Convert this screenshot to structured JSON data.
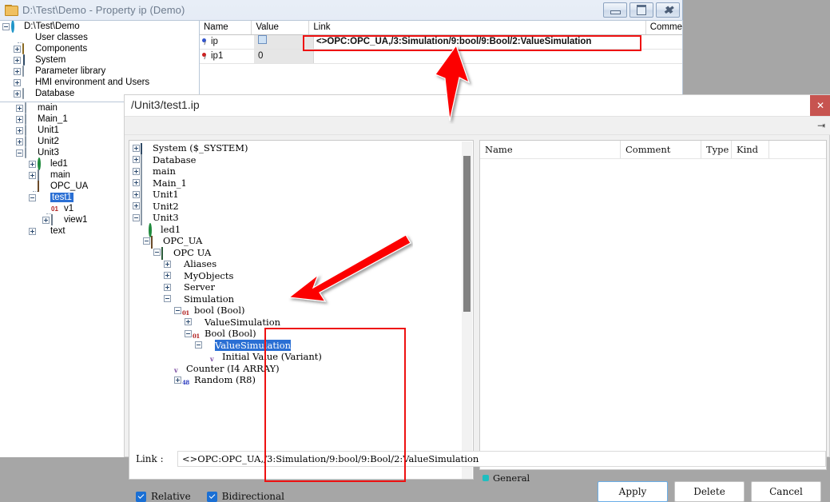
{
  "main_window": {
    "title": "D:\\Test\\Demo - Property ip (Demo)",
    "folder_icon": "folder-icon",
    "window_buttons": [
      {
        "name": "minimize-button",
        "glyph": "minimize"
      },
      {
        "name": "maximize-button",
        "glyph": "maximize"
      },
      {
        "name": "close-button",
        "glyph": "close"
      }
    ],
    "project_tree": [
      {
        "label": "D:\\Test\\Demo",
        "indent": 0,
        "twisty": "minus",
        "icon": "disc-icon"
      },
      {
        "label": "User classes",
        "indent": 1,
        "twisty": "none",
        "icon": "users-icon"
      },
      {
        "label": "Components",
        "indent": 1,
        "twisty": "plus",
        "icon": "components-icon"
      },
      {
        "label": "System",
        "indent": 1,
        "twisty": "plus",
        "icon": "system-icon"
      },
      {
        "label": "Parameter library",
        "indent": 1,
        "twisty": "plus",
        "icon": "folder-icon"
      },
      {
        "label": "HMI environment and Users",
        "indent": 1,
        "twisty": "plus",
        "icon": "hmi-icon"
      },
      {
        "label": "Database",
        "indent": 1,
        "twisty": "plus",
        "icon": "folder-icon"
      },
      {
        "label": "main",
        "indent": 1,
        "twisty": "plus",
        "icon": "folder-icon"
      },
      {
        "label": "Main_1",
        "indent": 1,
        "twisty": "plus",
        "icon": "folder-icon"
      },
      {
        "label": "Unit1",
        "indent": 1,
        "twisty": "plus",
        "icon": "folder-icon"
      },
      {
        "label": "Unit2",
        "indent": 1,
        "twisty": "plus",
        "icon": "folder-icon"
      },
      {
        "label": "Unit3",
        "indent": 1,
        "twisty": "minus",
        "icon": "folder-icon"
      },
      {
        "label": "led1",
        "indent": 2,
        "twisty": "plus",
        "icon": "led-icon"
      },
      {
        "label": "main",
        "indent": 2,
        "twisty": "plus",
        "icon": "image-icon"
      },
      {
        "label": "OPC_UA",
        "indent": 2,
        "twisty": "none",
        "icon": "opc-icon"
      },
      {
        "label": "test1",
        "indent": 2,
        "twisty": "minus",
        "icon": "users-icon",
        "selected": true
      },
      {
        "label": "v1",
        "indent": 3,
        "twisty": "none",
        "icon": "variable-icon"
      },
      {
        "label": "view1",
        "indent": 3,
        "twisty": "plus",
        "icon": "image-icon"
      },
      {
        "label": "text",
        "indent": 2,
        "twisty": "plus",
        "icon": "users-icon"
      }
    ],
    "property_table": {
      "columns": [
        "Name",
        "Value",
        "Link",
        "Comme"
      ],
      "rows": [
        {
          "name": "ip",
          "value": "",
          "value_is_checkbox": true,
          "link": "<>OPC:OPC_UA,/3:Simulation/9:bool/9:Bool/2:ValueSimulation",
          "comment": ""
        },
        {
          "name": "ip1",
          "value": "0",
          "value_is_checkbox": false,
          "link": "",
          "comment": ""
        }
      ]
    }
  },
  "dialog": {
    "title": "/Unit3/test1.ip",
    "close_label": "✕",
    "pin_label": "✕",
    "tree": [
      {
        "label": "System ($_SYSTEM)",
        "indent": 0,
        "twisty": "plus",
        "icon": "system-icon"
      },
      {
        "label": "Database",
        "indent": 0,
        "twisty": "plus",
        "icon": "folder-icon"
      },
      {
        "label": "main",
        "indent": 0,
        "twisty": "plus",
        "icon": "folder-icon"
      },
      {
        "label": "Main_1",
        "indent": 0,
        "twisty": "plus",
        "icon": "folder-icon"
      },
      {
        "label": "Unit1",
        "indent": 0,
        "twisty": "plus",
        "icon": "folder-icon"
      },
      {
        "label": "Unit2",
        "indent": 0,
        "twisty": "plus",
        "icon": "folder-icon"
      },
      {
        "label": "Unit3",
        "indent": 0,
        "twisty": "minus",
        "icon": "folder-icon"
      },
      {
        "label": "led1",
        "indent": 1,
        "twisty": "none",
        "icon": "led-icon"
      },
      {
        "label": "OPC_UA",
        "indent": 1,
        "twisty": "minus",
        "icon": "opc-icon"
      },
      {
        "label": "OPC UA",
        "indent": 2,
        "twisty": "minus",
        "icon": "opc-green-icon"
      },
      {
        "label": "Aliases",
        "indent": 3,
        "twisty": "plus",
        "icon": "node-icon"
      },
      {
        "label": "MyObjects",
        "indent": 3,
        "twisty": "plus",
        "icon": "node-icon"
      },
      {
        "label": "Server",
        "indent": 3,
        "twisty": "plus",
        "icon": "node-icon"
      },
      {
        "label": "Simulation",
        "indent": 3,
        "twisty": "minus",
        "icon": "node-icon"
      },
      {
        "label": "bool (Bool)",
        "indent": 4,
        "twisty": "minus",
        "icon": "bool-icon"
      },
      {
        "label": "ValueSimulation",
        "indent": 5,
        "twisty": "plus",
        "icon": "node-icon"
      },
      {
        "label": "Bool (Bool)",
        "indent": 5,
        "twisty": "minus",
        "icon": "bool-icon"
      },
      {
        "label": "ValueSimulation",
        "indent": 6,
        "twisty": "minus",
        "icon": "node-icon",
        "selected": true
      },
      {
        "label": "Initial Value (Variant)",
        "indent": 7,
        "twisty": "none",
        "icon": "variant-icon"
      },
      {
        "label": "Counter (I4 ARRAY)",
        "indent": 4,
        "twisty": "none",
        "icon": "variant-icon"
      },
      {
        "label": "Random (R8)",
        "indent": 4,
        "twisty": "plus",
        "icon": "r8-icon"
      }
    ],
    "right_table": {
      "columns": [
        "Name",
        "Comment",
        "Type",
        "Kind",
        ""
      ]
    },
    "general_tab": "General",
    "link_label": "Link :",
    "link_value": "<>OPC:OPC_UA,/3:Simulation/9:bool/9:Bool/2:ValueSimulation",
    "checkboxes": [
      {
        "label": "Relative",
        "checked": true
      },
      {
        "label": "Bidirectional",
        "checked": true
      }
    ],
    "buttons": [
      {
        "label": "Apply",
        "primary": true
      },
      {
        "label": "Delete",
        "primary": false
      },
      {
        "label": "Cancel",
        "primary": false
      }
    ]
  },
  "annotations": {
    "accent_color": "#ee1111",
    "highlight_link_box": "red-rect-around-link-cell",
    "highlight_tree_box": "red-rect-around-opcua-subtree",
    "arrows": [
      "arrow-up-to-link-cell",
      "arrow-down-left-to-tree-box"
    ]
  }
}
